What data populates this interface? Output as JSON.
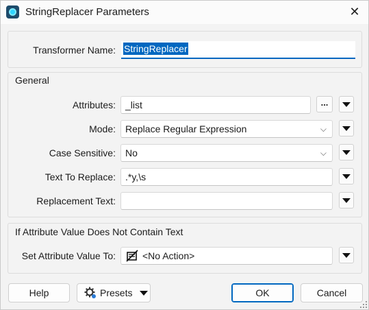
{
  "window": {
    "title": "StringReplacer Parameters"
  },
  "transformer": {
    "label": "Transformer Name:",
    "value": "StringReplacer"
  },
  "general": {
    "title": "General",
    "attributes": {
      "label": "Attributes:",
      "value": "_list",
      "more": "..."
    },
    "mode": {
      "label": "Mode:",
      "value": "Replace Regular Expression"
    },
    "case_sensitive": {
      "label": "Case Sensitive:",
      "value": "No"
    },
    "text_to_replace": {
      "label": "Text To Replace:",
      "value": ".*y,\\s"
    },
    "replacement_text": {
      "label": "Replacement Text:",
      "value": ""
    }
  },
  "no_text": {
    "title": "If Attribute Value Does Not Contain Text",
    "set_value": {
      "label": "Set Attribute Value To:",
      "value": "<No Action>"
    }
  },
  "buttons": {
    "help": "Help",
    "presets": "Presets",
    "ok": "OK",
    "cancel": "Cancel"
  },
  "colors": {
    "accent": "#0067c0",
    "background": "#f3f3f3"
  }
}
